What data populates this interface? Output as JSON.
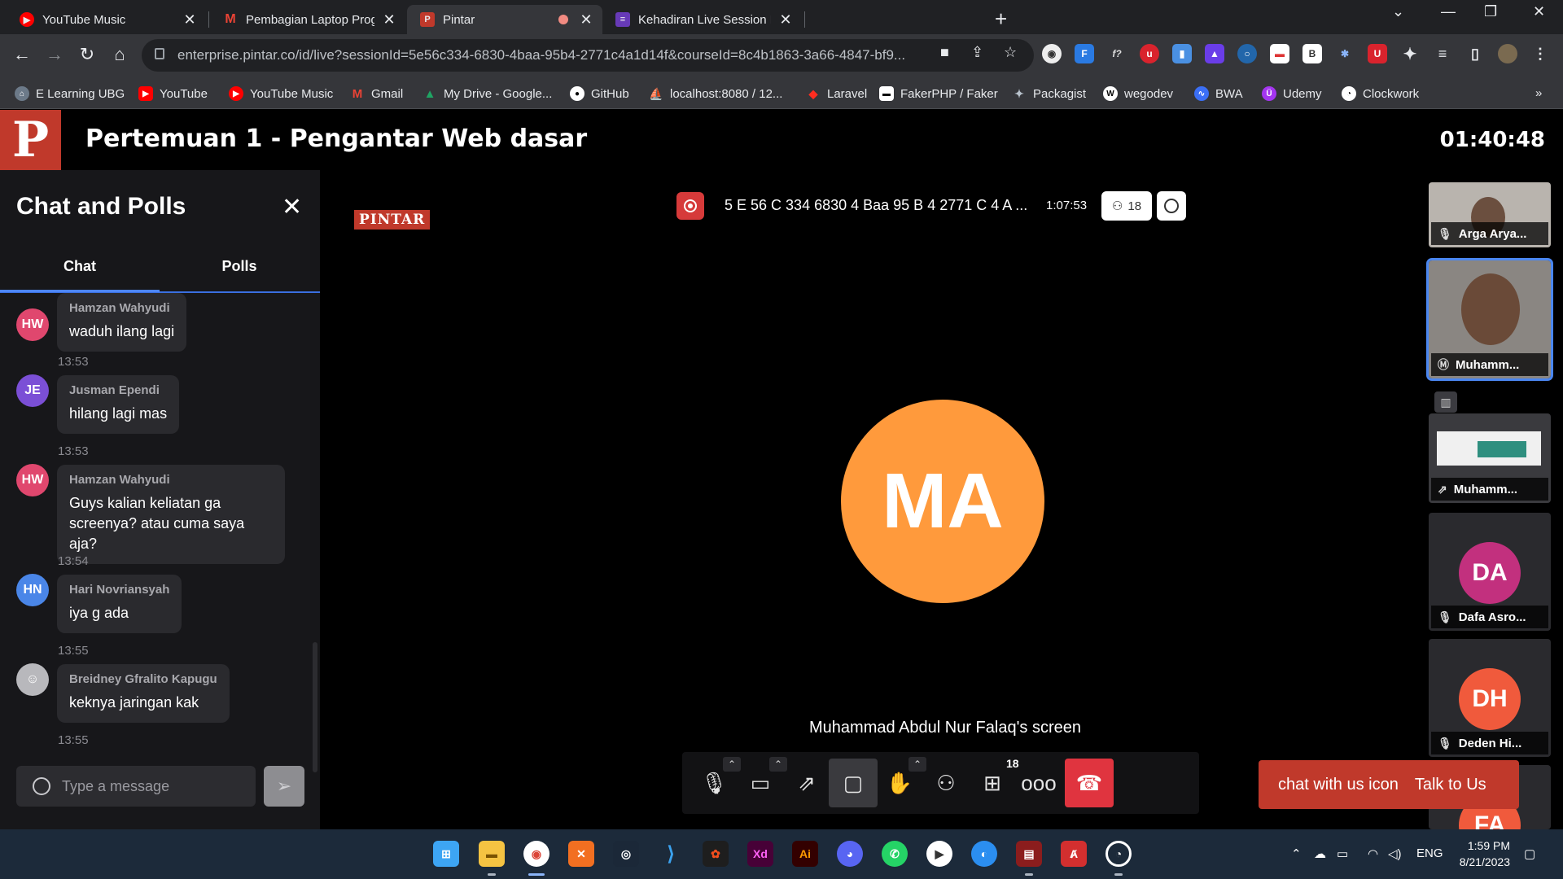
{
  "browser": {
    "tabs": [
      {
        "title": "YouTube Music",
        "icon": "youtube-music-icon",
        "color": "#ff0000"
      },
      {
        "title": "Pembagian Laptop Program AMI",
        "icon": "gmail-icon",
        "color": "#ea4335"
      },
      {
        "title": "Pintar",
        "icon": "pintar-icon",
        "color": "#c0392b"
      },
      {
        "title": "Kehadiran Live Session Peserta D",
        "icon": "forms-icon",
        "color": "#673ab7"
      }
    ],
    "url": "enterprise.pintar.co/id/live?sessionId=5e56c334-6830-4baa-95b4-2771c4a1d14f&courseId=8c4b1863-3a66-4847-bf9...",
    "bookmarks": [
      {
        "label": "E Learning UBG",
        "icon": "elearning-icon",
        "color": "#6c7a89"
      },
      {
        "label": "YouTube",
        "icon": "youtube-icon",
        "color": "#ff0000"
      },
      {
        "label": "YouTube Music",
        "icon": "youtube-music-icon",
        "color": "#ff0000"
      },
      {
        "label": "Gmail",
        "icon": "gmail-icon",
        "color": "#ea4335"
      },
      {
        "label": "My Drive - Google...",
        "icon": "google-drive-icon",
        "color": "#1fa463"
      },
      {
        "label": "GitHub",
        "icon": "github-icon",
        "color": "#ffffff"
      },
      {
        "label": "localhost:8080 / 12...",
        "icon": "phpmyadmin-icon",
        "color": "#f0a30a"
      },
      {
        "label": "Laravel",
        "icon": "laravel-icon",
        "color": "#ff2d20"
      },
      {
        "label": "FakerPHP / Faker",
        "icon": "faker-icon",
        "color": "#ffffff"
      },
      {
        "label": "Packagist",
        "icon": "packagist-icon",
        "color": "#b8c2cc"
      },
      {
        "label": "wegodev",
        "icon": "wegodev-icon",
        "color": "#ffffff"
      },
      {
        "label": "BWA",
        "icon": "bwa-icon",
        "color": "#3b6ff5"
      },
      {
        "label": "Udemy",
        "icon": "udemy-icon",
        "color": "#a435f0"
      },
      {
        "label": "Clockwork",
        "icon": "clockwork-icon",
        "color": "#ffffff"
      }
    ]
  },
  "header": {
    "session_title": "Pertemuan 1 - Pengantar Web dasar",
    "timer": "01:40:48",
    "logo_letter": "P"
  },
  "chat": {
    "title": "Chat and Polls",
    "tab_chat": "Chat",
    "tab_polls": "Polls",
    "messages": [
      {
        "initials": "HW",
        "name": "Hamzan Wahyudi",
        "text": "waduh ilang lagi",
        "time": "13:53",
        "color": "#e0476e"
      },
      {
        "initials": "JE",
        "name": "Jusman Ependi",
        "text": "hilang lagi mas",
        "time": "13:53",
        "color": "#7b4fd6"
      },
      {
        "initials": "HW",
        "name": "Hamzan Wahyudi",
        "text": "Guys kalian keliatan ga screenya? atau cuma saya aja?",
        "time": "13:54",
        "color": "#e0476e"
      },
      {
        "initials": "HN",
        "name": "Hari Novriansyah",
        "text": "iya g ada",
        "time": "13:55",
        "color": "#4a86e8"
      },
      {
        "initials": "",
        "name": "Breidney Gfralito Kapugu",
        "text": "keknya jaringan kak",
        "time": "13:55",
        "color": "#b8b8bc"
      }
    ],
    "input_placeholder": "Type a message"
  },
  "stage": {
    "brand_badge": "PINTAR",
    "meeting_id": "5 E 56 C 334 6830 4 Baa 95 B 4 2771 C 4 A ...",
    "elapsed": "1:07:53",
    "participant_count": "18",
    "main_initials": "MA",
    "main_color": "#ff9a3c",
    "screen_label": "Muhammad Abdul Nur Falaq's screen"
  },
  "controls": {
    "participants_badge": "18"
  },
  "participants": [
    {
      "name": "Arga Arya...",
      "kind": "video"
    },
    {
      "name": "Muhamm...",
      "kind": "video"
    },
    {
      "name": "Muhamm...",
      "kind": "screen"
    },
    {
      "name": "Dafa Asro...",
      "initials": "DA",
      "color": "#c2307e"
    },
    {
      "name": "Deden Hi...",
      "initials": "DH",
      "color": "#f05a3c"
    },
    {
      "name": "",
      "initials": "FA",
      "color": "#f05a3c"
    }
  ],
  "talk": {
    "icon_alt": "chat with us icon",
    "label": "Talk to Us"
  },
  "taskbar": {
    "lang": "ENG",
    "time": "1:59 PM",
    "date": "8/21/2023"
  }
}
